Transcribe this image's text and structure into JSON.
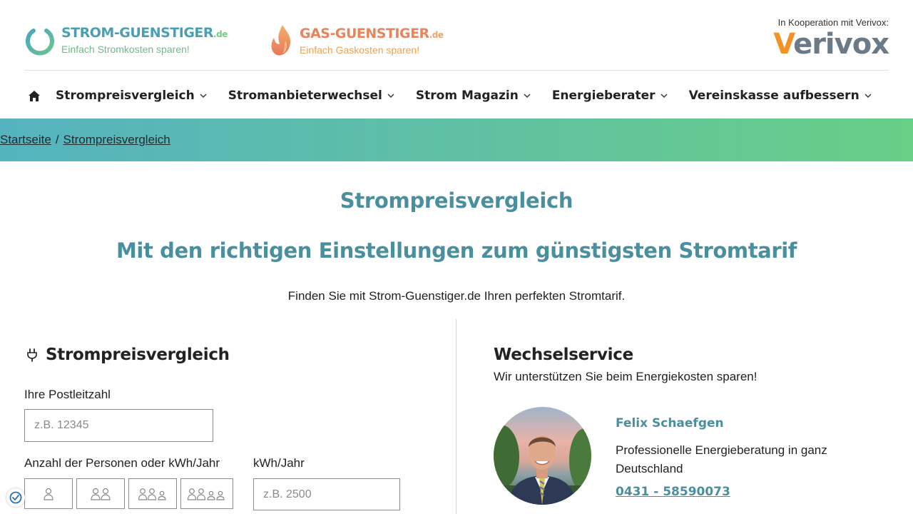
{
  "header": {
    "logo_strom": {
      "name": "STROM-GUENSTIGER",
      "tld": ".de",
      "tagline": "Einfach Stromkosten sparen!"
    },
    "logo_gas": {
      "name": "GAS-GUENSTIGER",
      "tld": ".de",
      "tagline": "Einfach Gaskosten sparen!"
    },
    "cooperation": {
      "label": "In Kooperation mit Verivox:",
      "brand_v": "V",
      "brand_rest": "erivox"
    }
  },
  "nav": {
    "items": [
      {
        "label": "Strompreisvergleich"
      },
      {
        "label": "Stromanbieterwechsel"
      },
      {
        "label": "Strom Magazin"
      },
      {
        "label": "Energieberater"
      },
      {
        "label": "Vereinskasse aufbessern"
      }
    ]
  },
  "breadcrumb": {
    "home": "Startseite",
    "separator": "/",
    "current": "Strompreisvergleich"
  },
  "main": {
    "title": "Strompreisvergleich",
    "subtitle": "Mit den richtigen Einstellungen zum günstigsten Stromtarif",
    "intro": "Finden Sie mit Strom-Guenstiger.de Ihren perfekten Stromtarif."
  },
  "form": {
    "title": "Strompreisvergleich",
    "postcode_label": "Ihre Postleitzahl",
    "postcode_placeholder": "z.B. 12345",
    "persons_label": "Anzahl der Personen oder kWh/Jahr",
    "kwh_label": "kWh/Jahr",
    "kwh_placeholder": "z.B. 2500"
  },
  "service": {
    "title": "Wechselservice",
    "subtitle": "Wir unterstützen Sie beim Energiekosten sparen!",
    "advisor_name": "Felix Schaefgen",
    "advisor_desc": "Professionelle Energieberatung in ganz Deutschland",
    "advisor_phone": "0431 - 58590073"
  },
  "colors": {
    "brand_teal": "#4a8f9e",
    "brand_green": "#67cf86",
    "gas_orange": "#e8845c",
    "verivox_orange": "#f39325",
    "verivox_gray": "#6b7a86"
  }
}
